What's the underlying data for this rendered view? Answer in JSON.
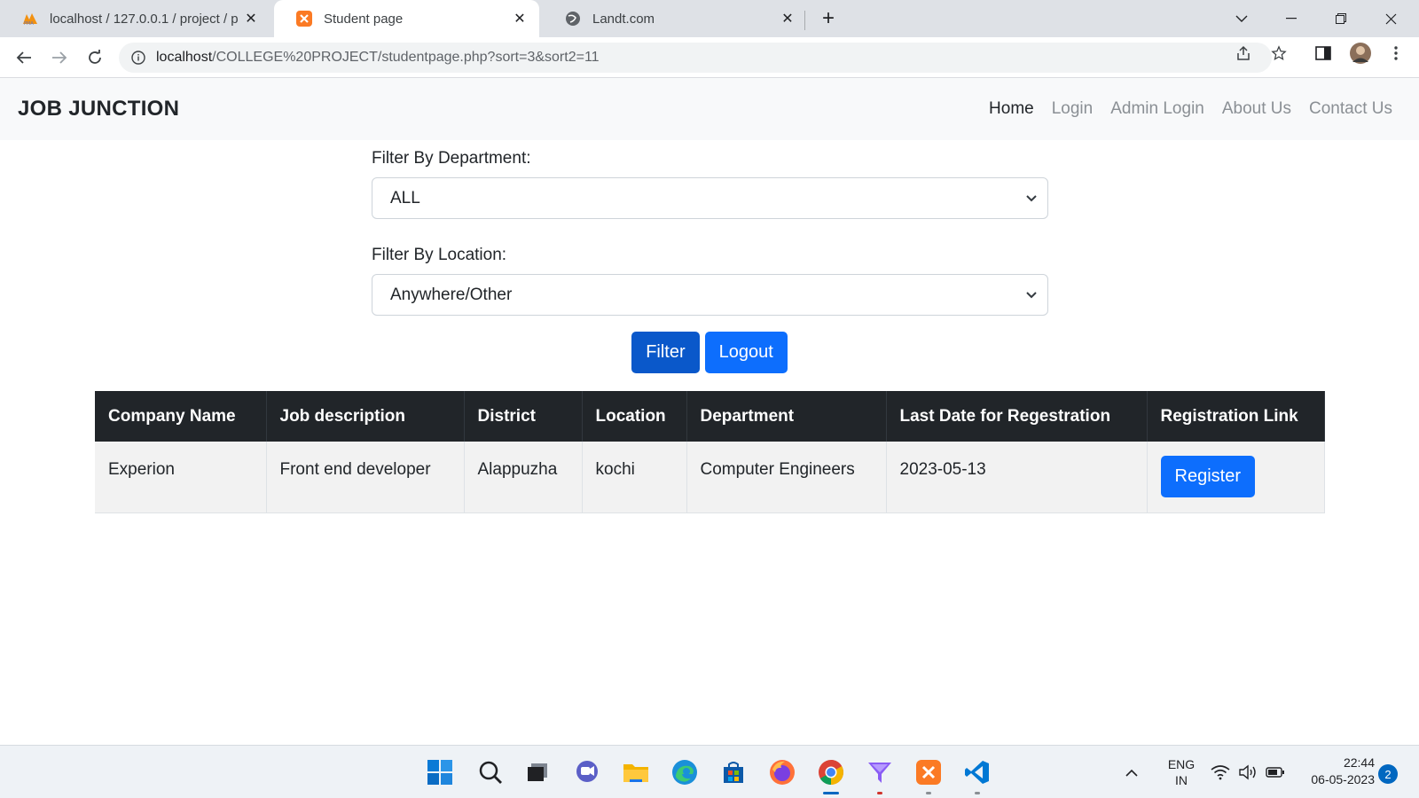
{
  "browser": {
    "tabs": [
      {
        "title": "localhost / 127.0.0.1 / project / p",
        "icon": "phpmyadmin-icon",
        "active": false
      },
      {
        "title": "Student page",
        "icon": "xampp-icon",
        "active": true
      },
      {
        "title": "Landt.com",
        "icon": "globe-icon",
        "active": false
      }
    ],
    "url_host": "localhost",
    "url_path": "/COLLEGE%20PROJECT/studentpage.php?sort=3&sort2=11"
  },
  "navbar": {
    "brand": "JOB JUNCTION",
    "links": [
      "Home",
      "Login",
      "Admin Login",
      "About Us",
      "Contact Us"
    ]
  },
  "filters": {
    "department_label": "Filter By Department:",
    "department_value": "ALL",
    "location_label": "Filter By Location:",
    "location_value": "Anywhere/Other",
    "filter_button": "Filter",
    "logout_button": "Logout"
  },
  "table": {
    "headers": [
      "Company Name",
      "Job description",
      "District",
      "Location",
      "Department",
      "Last Date for Regestration",
      "Registration Link"
    ],
    "rows": [
      {
        "company": "Experion",
        "description": "Front end developer",
        "district": "Alappuzha",
        "location": "kochi",
        "department": "Computer Engineers",
        "last_date": "2023-05-13",
        "link_label": "Register"
      }
    ]
  },
  "taskbar": {
    "lang_top": "ENG",
    "lang_bottom": "IN",
    "time": "22:44",
    "date": "06-05-2023",
    "notifications": "2"
  },
  "colors": {
    "primary": "#0d6efd",
    "table_header": "#212529",
    "navbar_bg": "#f8f9fa"
  }
}
